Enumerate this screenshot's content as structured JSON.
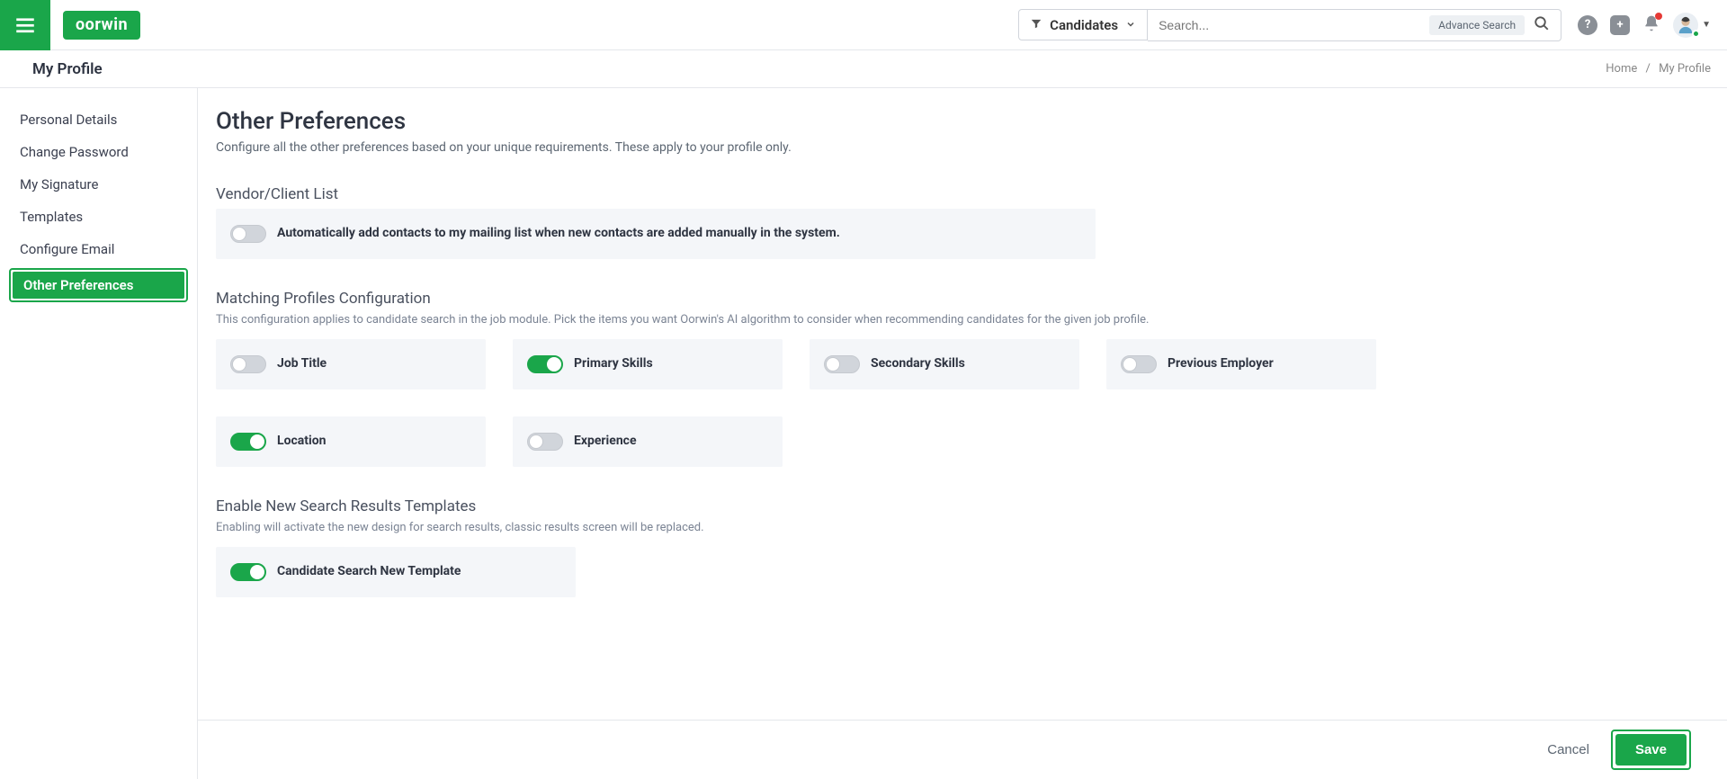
{
  "header": {
    "filter_label": "Candidates",
    "search_placeholder": "Search...",
    "advance_search": "Advance Search",
    "logo_text": "oorwin"
  },
  "subheader": {
    "title": "My Profile",
    "breadcrumb_home": "Home",
    "breadcrumb_current": "My Profile"
  },
  "sidebar": {
    "items": [
      "Personal Details",
      "Change Password",
      "My Signature",
      "Templates",
      "Configure Email",
      "Other Preferences"
    ]
  },
  "page": {
    "title": "Other Preferences",
    "desc": "Configure all the other preferences based on your unique requirements. These apply to your profile only."
  },
  "vendor": {
    "title": "Vendor/Client List",
    "toggle_label": "Automatically add contacts to my mailing list when new contacts are added manually in the system."
  },
  "matching": {
    "title": "Matching Profiles Configuration",
    "desc": "This configuration applies to candidate search in the job module. Pick the items you want Oorwin's AI algorithm to consider when recommending candidates for the given job profile.",
    "options": {
      "job_title": "Job Title",
      "primary_skills": "Primary Skills",
      "secondary_skills": "Secondary Skills",
      "previous_employer": "Previous Employer",
      "location": "Location",
      "experience": "Experience"
    }
  },
  "search_templates": {
    "title": "Enable New Search Results Templates",
    "desc": "Enabling will activate the new design for search results, classic results screen will be replaced.",
    "toggle_label": "Candidate Search New Template"
  },
  "footer": {
    "cancel": "Cancel",
    "save": "Save"
  }
}
